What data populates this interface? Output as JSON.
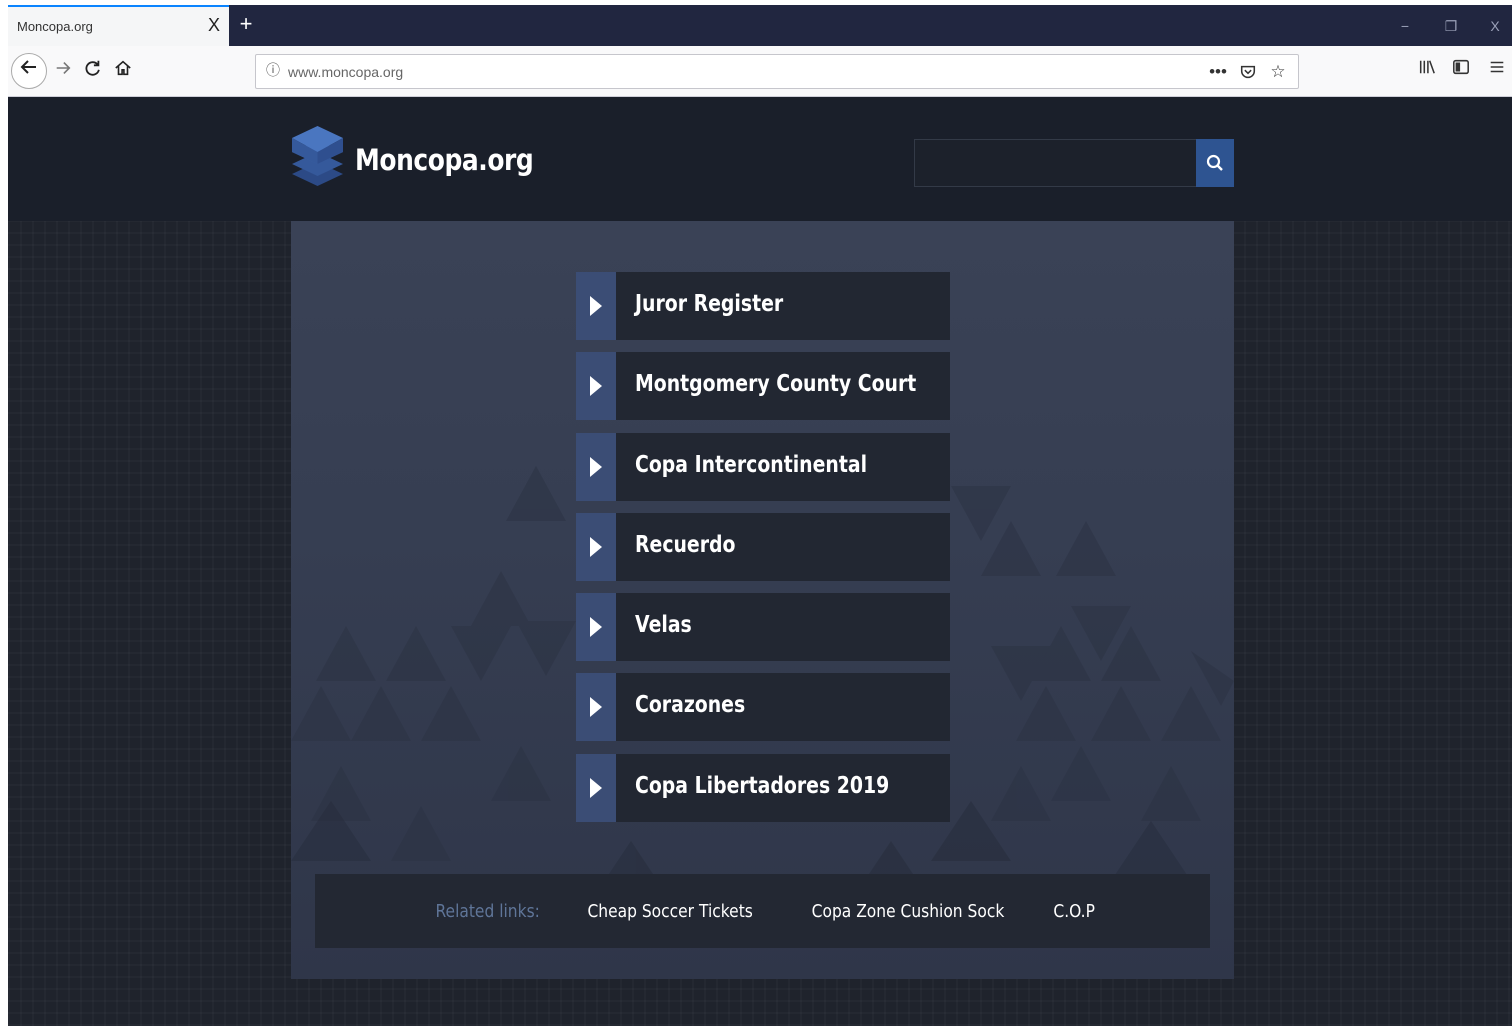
{
  "browser": {
    "tab_title": "Moncopa.org",
    "tab_close": "X",
    "new_tab": "+",
    "url": "www.moncopa.org",
    "window_minimize": "−",
    "window_restore": "❐",
    "window_close": "X"
  },
  "site": {
    "logo_text": "Moncopa.org",
    "search_placeholder": ""
  },
  "menu": [
    {
      "label": "Juror Register"
    },
    {
      "label": "Montgomery County Court"
    },
    {
      "label": "Copa Intercontinental"
    },
    {
      "label": "Recuerdo"
    },
    {
      "label": "Velas"
    },
    {
      "label": "Corazones"
    },
    {
      "label": "Copa Libertadores 2019"
    }
  ],
  "related": {
    "label": "Related links:",
    "links": [
      "Cheap Soccer Tickets",
      "Copa Zone Cushion Sock",
      "C.O.P"
    ]
  },
  "colors": {
    "header_bg": "#1a1f2a",
    "panel_bg": "#3a4256",
    "accent_blue": "#2e5491",
    "menu_arrow_bg": "#3b4d75"
  }
}
